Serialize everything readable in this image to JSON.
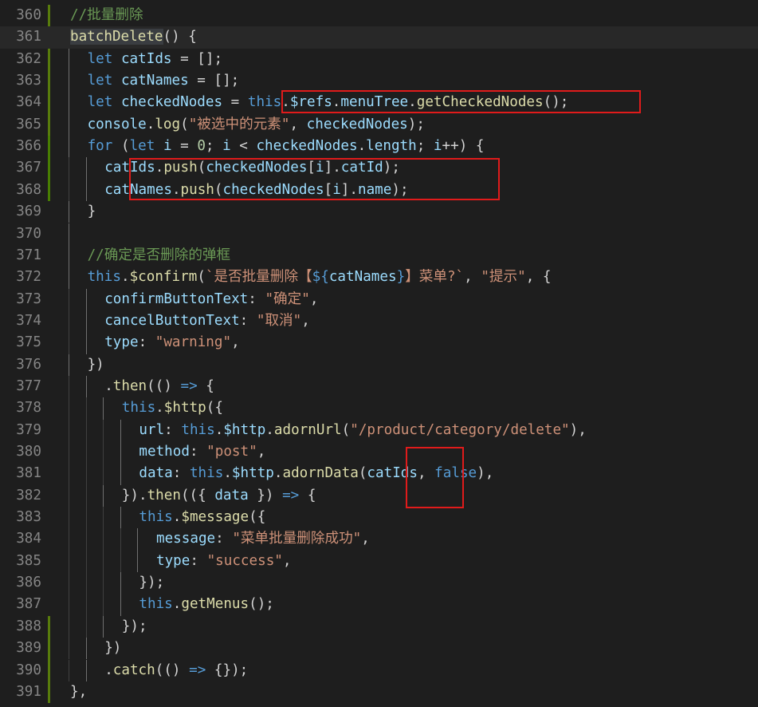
{
  "colors": {
    "background": "#1e1e1e",
    "line_number": "#858585",
    "modified_gutter": "#587c0c",
    "added_gutter": "#487e02",
    "current_line": "#282828",
    "token": {
      "c": "#6a9955",
      "k": "#569cd6",
      "f": "#dcdcaa",
      "v": "#9cdcfe",
      "s": "#ce9178",
      "n": "#b5cea8",
      "p": "#d4d4d4",
      "t": "#ce9178",
      "x": "#d4d4d4"
    },
    "annotation_box": "#e01b1b"
  },
  "lines": [
    {
      "num": "360",
      "indent": 2,
      "tokens": [
        [
          "c",
          "//批量删除"
        ]
      ]
    },
    {
      "num": "361",
      "indent": 2,
      "current": true,
      "tokens": [
        [
          "fh",
          "batchDelete"
        ],
        [
          "p",
          "() {"
        ]
      ]
    },
    {
      "num": "362",
      "indent": 3,
      "tokens": [
        [
          "k",
          "let"
        ],
        [
          "p",
          " "
        ],
        [
          "v",
          "catIds"
        ],
        [
          "p",
          " = [];"
        ]
      ]
    },
    {
      "num": "363",
      "indent": 3,
      "tokens": [
        [
          "k",
          "let"
        ],
        [
          "p",
          " "
        ],
        [
          "v",
          "catNames"
        ],
        [
          "p",
          " = [];"
        ]
      ]
    },
    {
      "num": "364",
      "indent": 3,
      "tokens": [
        [
          "k",
          "let"
        ],
        [
          "p",
          " "
        ],
        [
          "v",
          "checkedNodes"
        ],
        [
          "p",
          " = "
        ],
        [
          "k",
          "this"
        ],
        [
          "p",
          "."
        ],
        [
          "v",
          "$refs"
        ],
        [
          "p",
          "."
        ],
        [
          "v",
          "menuTree"
        ],
        [
          "p",
          "."
        ],
        [
          "f",
          "getCheckedNodes"
        ],
        [
          "p",
          "();"
        ]
      ]
    },
    {
      "num": "365",
      "indent": 3,
      "tokens": [
        [
          "v",
          "console"
        ],
        [
          "p",
          "."
        ],
        [
          "f",
          "log"
        ],
        [
          "p",
          "("
        ],
        [
          "s",
          "\"被选中的元素\""
        ],
        [
          "p",
          ", "
        ],
        [
          "v",
          "checkedNodes"
        ],
        [
          "p",
          ");"
        ]
      ]
    },
    {
      "num": "366",
      "indent": 3,
      "tokens": [
        [
          "k",
          "for"
        ],
        [
          "p",
          " ("
        ],
        [
          "k",
          "let"
        ],
        [
          "p",
          " "
        ],
        [
          "v",
          "i"
        ],
        [
          "p",
          " = "
        ],
        [
          "n",
          "0"
        ],
        [
          "p",
          "; "
        ],
        [
          "v",
          "i"
        ],
        [
          "p",
          " < "
        ],
        [
          "v",
          "checkedNodes"
        ],
        [
          "p",
          "."
        ],
        [
          "v",
          "length"
        ],
        [
          "p",
          "; "
        ],
        [
          "v",
          "i"
        ],
        [
          "p",
          "++) {"
        ]
      ]
    },
    {
      "num": "367",
      "indent": 4,
      "tokens": [
        [
          "v",
          "catIds"
        ],
        [
          "p",
          "."
        ],
        [
          "f",
          "push"
        ],
        [
          "p",
          "("
        ],
        [
          "v",
          "checkedNodes"
        ],
        [
          "p",
          "["
        ],
        [
          "v",
          "i"
        ],
        [
          "p",
          "]."
        ],
        [
          "v",
          "catId"
        ],
        [
          "p",
          ");"
        ]
      ]
    },
    {
      "num": "368",
      "indent": 4,
      "tokens": [
        [
          "v",
          "catNames"
        ],
        [
          "p",
          "."
        ],
        [
          "f",
          "push"
        ],
        [
          "p",
          "("
        ],
        [
          "v",
          "checkedNodes"
        ],
        [
          "p",
          "["
        ],
        [
          "v",
          "i"
        ],
        [
          "p",
          "]."
        ],
        [
          "v",
          "name"
        ],
        [
          "p",
          ");"
        ]
      ]
    },
    {
      "num": "369",
      "indent": 3,
      "tokens": [
        [
          "p",
          "}"
        ]
      ]
    },
    {
      "num": "370",
      "indent": 3,
      "tokens": []
    },
    {
      "num": "371",
      "indent": 3,
      "tokens": [
        [
          "c",
          "//确定是否删除的弹框"
        ]
      ]
    },
    {
      "num": "372",
      "indent": 3,
      "tokens": [
        [
          "k",
          "this"
        ],
        [
          "p",
          "."
        ],
        [
          "f",
          "$confirm"
        ],
        [
          "p",
          "("
        ],
        [
          "t",
          "`是否批量删除【"
        ],
        [
          "k",
          "${"
        ],
        [
          "v",
          "catNames"
        ],
        [
          "k",
          "}"
        ],
        [
          "t",
          "】菜单?`"
        ],
        [
          "p",
          ", "
        ],
        [
          "s",
          "\"提示\""
        ],
        [
          "p",
          ", {"
        ]
      ]
    },
    {
      "num": "373",
      "indent": 4,
      "tokens": [
        [
          "v",
          "confirmButtonText"
        ],
        [
          "p",
          ": "
        ],
        [
          "s",
          "\"确定\""
        ],
        [
          "p",
          ","
        ]
      ]
    },
    {
      "num": "374",
      "indent": 4,
      "tokens": [
        [
          "v",
          "cancelButtonText"
        ],
        [
          "p",
          ": "
        ],
        [
          "s",
          "\"取消\""
        ],
        [
          "p",
          ","
        ]
      ]
    },
    {
      "num": "375",
      "indent": 4,
      "tokens": [
        [
          "v",
          "type"
        ],
        [
          "p",
          ": "
        ],
        [
          "s",
          "\"warning\""
        ],
        [
          "p",
          ","
        ]
      ]
    },
    {
      "num": "376",
      "indent": 3,
      "tokens": [
        [
          "p",
          "})"
        ]
      ]
    },
    {
      "num": "377",
      "indent": 4,
      "tokens": [
        [
          "p",
          "."
        ],
        [
          "f",
          "then"
        ],
        [
          "p",
          "(() "
        ],
        [
          "k",
          "=>"
        ],
        [
          "p",
          " {"
        ]
      ]
    },
    {
      "num": "378",
      "indent": 5,
      "tokens": [
        [
          "k",
          "this"
        ],
        [
          "p",
          "."
        ],
        [
          "f",
          "$http"
        ],
        [
          "p",
          "({"
        ]
      ]
    },
    {
      "num": "379",
      "indent": 6,
      "tokens": [
        [
          "v",
          "url"
        ],
        [
          "p",
          ": "
        ],
        [
          "k",
          "this"
        ],
        [
          "p",
          "."
        ],
        [
          "v",
          "$http"
        ],
        [
          "p",
          "."
        ],
        [
          "f",
          "adornUrl"
        ],
        [
          "p",
          "("
        ],
        [
          "s",
          "\"/product/category/delete\""
        ],
        [
          "p",
          "),"
        ]
      ]
    },
    {
      "num": "380",
      "indent": 6,
      "tokens": [
        [
          "v",
          "method"
        ],
        [
          "p",
          ": "
        ],
        [
          "s",
          "\"post\""
        ],
        [
          "p",
          ","
        ]
      ]
    },
    {
      "num": "381",
      "indent": 6,
      "tokens": [
        [
          "v",
          "data"
        ],
        [
          "p",
          ": "
        ],
        [
          "k",
          "this"
        ],
        [
          "p",
          "."
        ],
        [
          "v",
          "$http"
        ],
        [
          "p",
          "."
        ],
        [
          "f",
          "adornData"
        ],
        [
          "p",
          "("
        ],
        [
          "v",
          "catIds"
        ],
        [
          "p",
          ", "
        ],
        [
          "k",
          "false"
        ],
        [
          "p",
          "),"
        ]
      ]
    },
    {
      "num": "382",
      "indent": 5,
      "tokens": [
        [
          "p",
          "})."
        ],
        [
          "f",
          "then"
        ],
        [
          "p",
          "(({ "
        ],
        [
          "v",
          "data"
        ],
        [
          "p",
          " }) "
        ],
        [
          "k",
          "=>"
        ],
        [
          "p",
          " {"
        ]
      ]
    },
    {
      "num": "383",
      "indent": 6,
      "tokens": [
        [
          "k",
          "this"
        ],
        [
          "p",
          "."
        ],
        [
          "f",
          "$message"
        ],
        [
          "p",
          "({"
        ]
      ]
    },
    {
      "num": "384",
      "indent": 7,
      "tokens": [
        [
          "v",
          "message"
        ],
        [
          "p",
          ": "
        ],
        [
          "s",
          "\"菜单批量删除成功\""
        ],
        [
          "p",
          ","
        ]
      ]
    },
    {
      "num": "385",
      "indent": 7,
      "tokens": [
        [
          "v",
          "type"
        ],
        [
          "p",
          ": "
        ],
        [
          "s",
          "\"success\""
        ],
        [
          "p",
          ","
        ]
      ]
    },
    {
      "num": "386",
      "indent": 6,
      "tokens": [
        [
          "p",
          "});"
        ]
      ]
    },
    {
      "num": "387",
      "indent": 6,
      "tokens": [
        [
          "k",
          "this"
        ],
        [
          "p",
          "."
        ],
        [
          "f",
          "getMenus"
        ],
        [
          "p",
          "();"
        ]
      ]
    },
    {
      "num": "388",
      "indent": 5,
      "tokens": [
        [
          "p",
          "});"
        ]
      ]
    },
    {
      "num": "389",
      "indent": 4,
      "tokens": [
        [
          "p",
          "})"
        ]
      ]
    },
    {
      "num": "390",
      "indent": 4,
      "tokens": [
        [
          "p",
          "."
        ],
        [
          "f",
          "catch"
        ],
        [
          "p",
          "(() "
        ],
        [
          "k",
          "=>"
        ],
        [
          "p",
          " {});"
        ]
      ]
    },
    {
      "num": "391",
      "indent": 2,
      "tokens": [
        [
          "p",
          "},"
        ]
      ]
    }
  ]
}
